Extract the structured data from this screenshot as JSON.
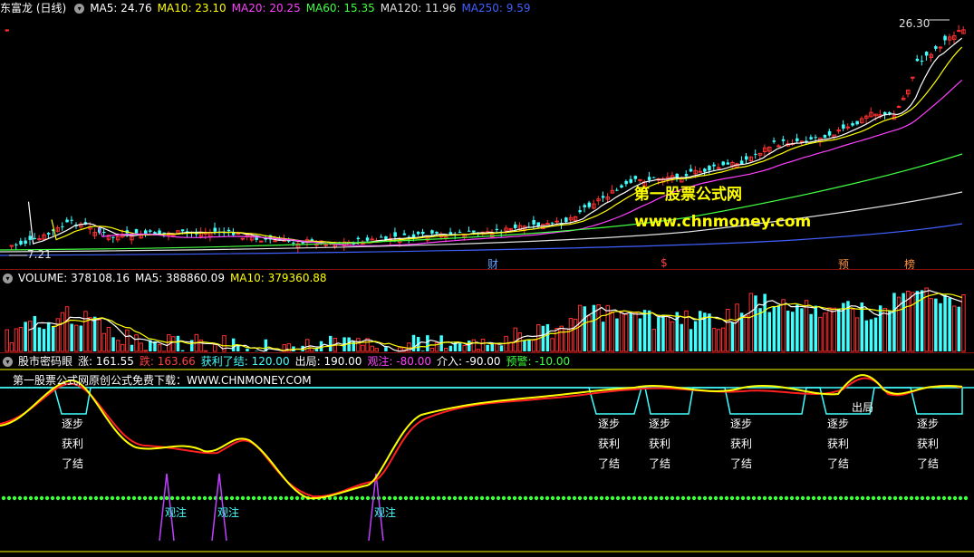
{
  "main": {
    "title": "东富龙 (日线)",
    "ma": [
      {
        "label": "MA5: 24.76",
        "color": "#ffffff"
      },
      {
        "label": "MA10: 23.10",
        "color": "#ffff00"
      },
      {
        "label": "MA20: 20.25",
        "color": "#ff40ff"
      },
      {
        "label": "MA60: 15.35",
        "color": "#40ff40"
      },
      {
        "label": "MA120: 11.96",
        "color": "#e0e0e0"
      },
      {
        "label": "MA250: 9.59",
        "color": "#4060ff"
      }
    ],
    "high_label": "26.30",
    "low_label": "7.21",
    "event_labels": [
      {
        "text": "财",
        "color": "#60a0ff"
      },
      {
        "text": "$",
        "color": "#ff4040"
      },
      {
        "text": "预",
        "color": "#ff9040"
      },
      {
        "text": "榜",
        "color": "#ff9040"
      }
    ],
    "watermark_title": "第一股票公式网",
    "watermark_url": "www.chnmoney.com"
  },
  "volume": {
    "label_volume": "VOLUME: 378108.16",
    "label_ma5": "MA5: 388860.09",
    "label_ma10": "MA10: 379360.88"
  },
  "indicator": {
    "name": "股市密码眼",
    "items": [
      {
        "label": "涨: 161.55",
        "color": "#ffffff"
      },
      {
        "label": "跌: 163.66",
        "color": "#ff4040"
      },
      {
        "label": "获利了结: 120.00",
        "color": "#40ffff"
      },
      {
        "label": "出局: 190.00",
        "color": "#ffffff"
      },
      {
        "label": "观注: -80.00",
        "color": "#ff40ff"
      },
      {
        "label": "介入: -90.00",
        "color": "#ffffff"
      },
      {
        "label": "预警: -10.00",
        "color": "#40ff40"
      }
    ],
    "banner": "第一股票公式网原创公式免费下载：WWW.CHNMONEY.COM",
    "signal_line1": "逐步",
    "signal_line2": "获利",
    "signal_line3": "了结",
    "watch_label": "观注",
    "exit_label": "出局"
  }
}
